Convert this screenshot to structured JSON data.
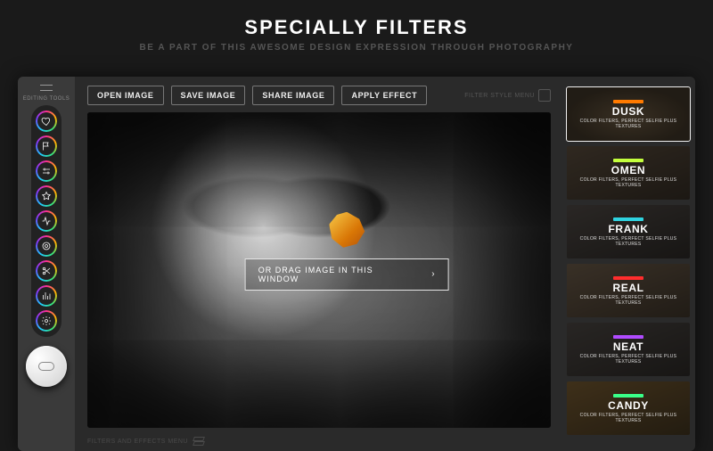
{
  "hero": {
    "title": "SPECIALLY FILTERS",
    "subtitle": "BE A PART OF THIS AWESOME DESIGN EXPRESSION THROUGH PHOTOGRAPHY"
  },
  "sidebar": {
    "label": "EDITING TOOLS",
    "tools": [
      {
        "name": "heart-icon"
      },
      {
        "name": "flag-icon"
      },
      {
        "name": "sliders-icon"
      },
      {
        "name": "star-icon"
      },
      {
        "name": "activity-icon"
      },
      {
        "name": "target-icon"
      },
      {
        "name": "scissors-icon"
      },
      {
        "name": "equalizer-icon"
      },
      {
        "name": "gear-icon"
      }
    ]
  },
  "toolbar": {
    "open": "OPEN IMAGE",
    "save": "SAVE IMAGE",
    "share": "SHARE IMAGE",
    "apply": "APPLY EFFECT",
    "right_label": "FILTER STYLE MENU"
  },
  "canvas": {
    "drag_label": "OR DRAG IMAGE IN THIS WINDOW"
  },
  "bottom": {
    "label": "FILTERS AND EFFECTS MENU"
  },
  "filters": {
    "subtitle": "COLOR FILTERS, PERFECT SELFIE PLUS TEXTURES",
    "items": [
      {
        "name": "DUSK",
        "accent": "#ff7a00",
        "selected": true,
        "thumb": "t-dusk"
      },
      {
        "name": "OMEN",
        "accent": "#c4ff3d",
        "selected": false,
        "thumb": "t-omen"
      },
      {
        "name": "FRANK",
        "accent": "#2fd3e0",
        "selected": false,
        "thumb": "t-frank"
      },
      {
        "name": "REAL",
        "accent": "#ff2d2d",
        "selected": false,
        "thumb": "t-real"
      },
      {
        "name": "NEAT",
        "accent": "#b04bff",
        "selected": false,
        "thumb": "t-neat"
      },
      {
        "name": "CANDY",
        "accent": "#39ff88",
        "selected": false,
        "thumb": "t-candy"
      }
    ]
  }
}
